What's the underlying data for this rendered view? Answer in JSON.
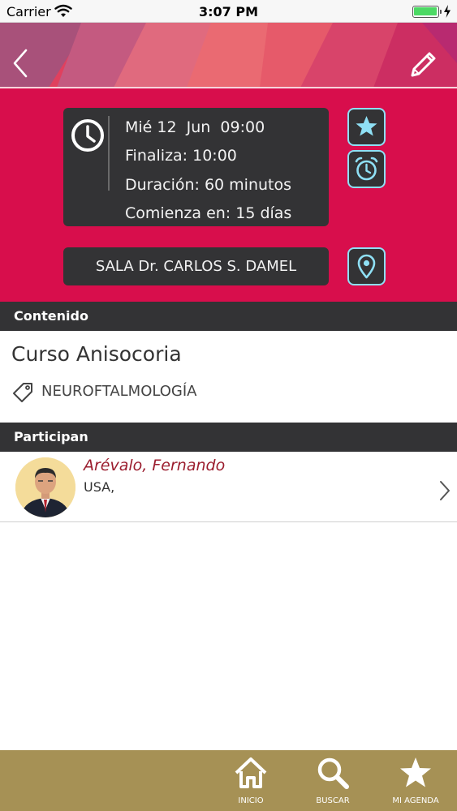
{
  "status_bar": {
    "carrier": "Carrier",
    "time": "3:07 PM"
  },
  "nav": {
    "back_icon": "chevron-left-icon",
    "edit_icon": "pencil-icon"
  },
  "session": {
    "date_line": "Mié 12  Jun  09:00",
    "end_line": "Finaliza: 10:00",
    "duration_line": "Duración: 60 minutos",
    "starts_in_line": "Comienza en: 15 días",
    "room": "SALA Dr. CARLOS S. DAMEL"
  },
  "content_section": {
    "header": "Contenido",
    "title": "Curso Anisocoria",
    "topic": "NEUROFTALMOLOGÍA"
  },
  "participants_section": {
    "header": "Participan",
    "items": [
      {
        "name": "Arévalo, Fernando",
        "country": "USA,"
      }
    ]
  },
  "tabs": [
    {
      "label": "INICIO",
      "icon": "home-icon"
    },
    {
      "label": "BUSCAR",
      "icon": "search-icon"
    },
    {
      "label": "MI AGENDA",
      "icon": "star-icon"
    }
  ],
  "colors": {
    "primary": "#d80e4c",
    "card": "#333335",
    "accent": "#8fe0f5",
    "tabbar": "#a69155",
    "participant_name": "#9b1d2e"
  }
}
